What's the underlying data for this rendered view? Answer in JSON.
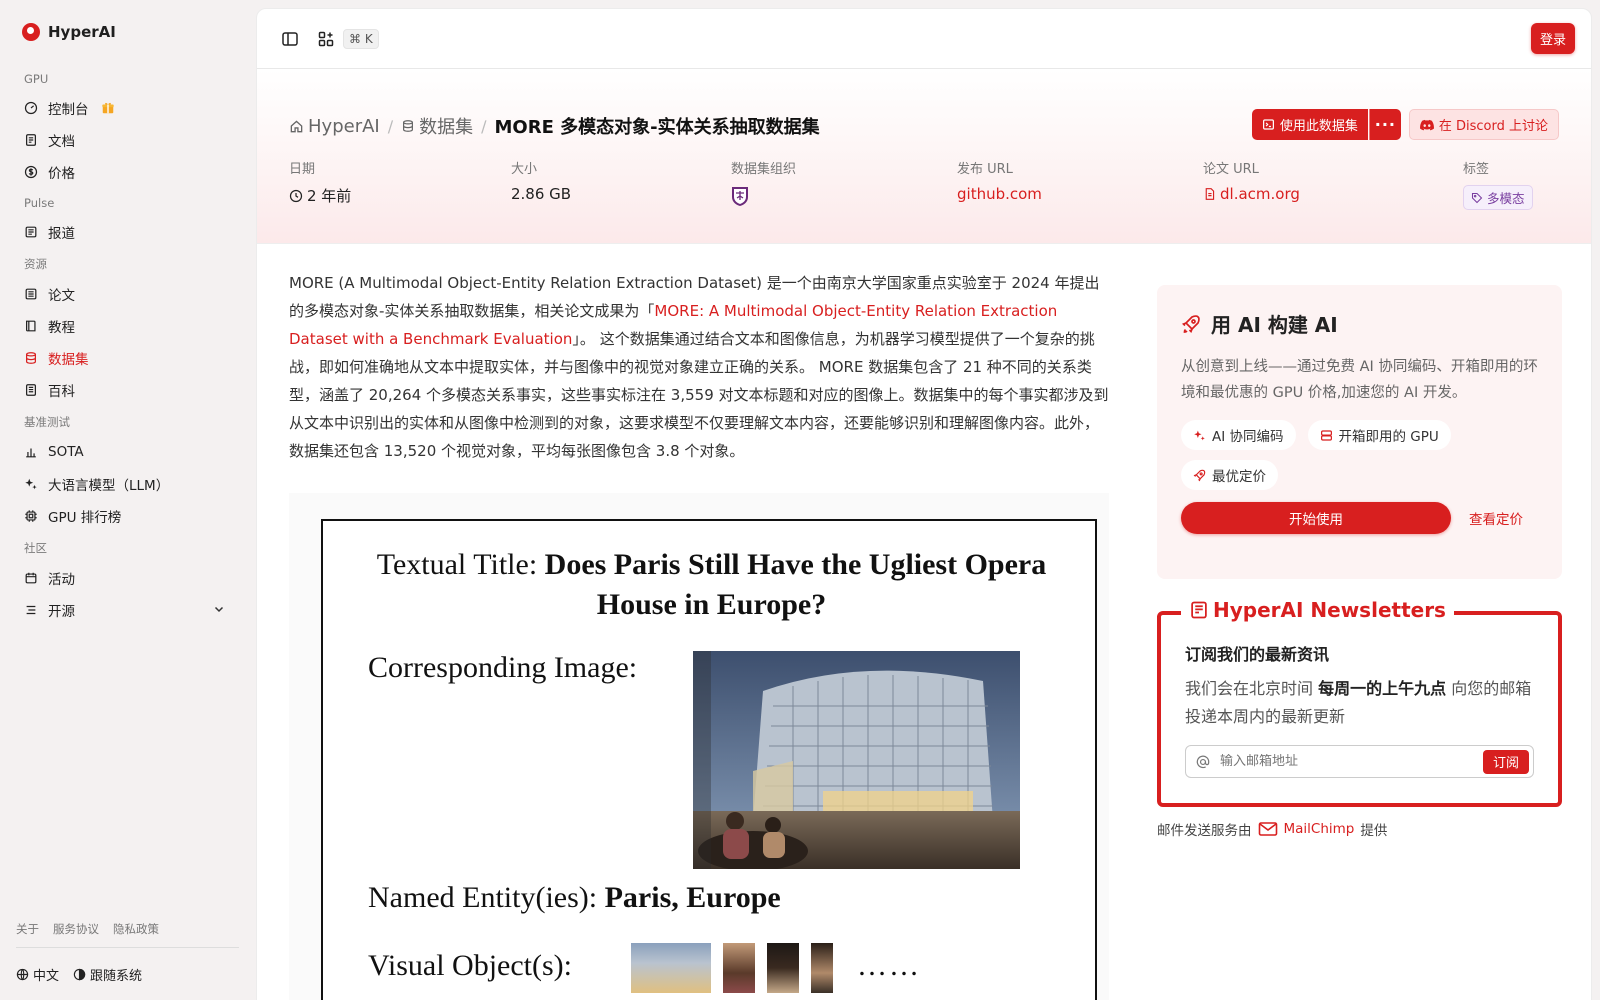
{
  "sidebar": {
    "brand": "HyperAI",
    "sections": {
      "gpu": "GPU",
      "pulse": "Pulse",
      "resources": "资源",
      "bench": "基准测试",
      "community": "社区"
    },
    "items": {
      "console": "控制台",
      "docs": "文档",
      "pricing": "价格",
      "reports": "报道",
      "papers": "论文",
      "tutorials": "教程",
      "datasets": "数据集",
      "wiki": "百科",
      "sota": "SOTA",
      "llm": "大语言模型（LLM）",
      "gpu_rank": "GPU 排行榜",
      "events": "活动",
      "opensource": "开源"
    },
    "footer_links": [
      "关于",
      "服务协议",
      "隐私政策"
    ],
    "language": "中文",
    "theme": "跟随系统"
  },
  "topbar": {
    "shortcut": "⌘ K",
    "login": "登录"
  },
  "hero": {
    "crumb_home": "HyperAI",
    "crumb_datasets": "数据集",
    "crumb_current": "MORE 多模态对象-实体关系抽取数据集",
    "btn_use": "使用此数据集",
    "btn_discord": "在 Discord 上讨论",
    "meta": {
      "date_label": "日期",
      "date_value": "2 年前",
      "size_label": "大小",
      "size_value": "2.86 GB",
      "org_label": "数据集组织",
      "release_label": "发布 URL",
      "release_value": "github.com",
      "paper_label": "论文 URL",
      "paper_value": "dl.acm.org",
      "tags_label": "标签",
      "tag_value": "多模态"
    }
  },
  "content": {
    "desc_before": "MORE (A Multimodal Object-Entity Relation Extraction Dataset) 是一个由南京大学国家重点实验室于 2024 年提出的多模态对象-实体关系抽取数据集，相关论文成果为「",
    "desc_link": "MORE: A Multimodal Object-Entity Relation Extraction Dataset with a Benchmark Evaluation",
    "desc_after": "」。 这个数据集通过结合文本和图像信息，为机器学习模型提供了一个复杂的挑战，即如何准确地从文本中提取实体，并与图像中的视觉对象建立正确的关系。 MORE 数据集包含了 21 种不同的关系类型，涵盖了 20,264 个多模态关系事实，这些事实标注在 3,559 对文本标题和对应的图像上。数据集中的每个事实都涉及到从文本中识别出的实体和从图像中检测到的对象，这要求模型不仅要理解文本内容，还要能够识别和理解图像内容。此外，数据集还包含 13,520 个视觉对象，平均每张图像包含 3.8 个对象。",
    "figure": {
      "title_prefix": "Textual Title: ",
      "title_bold": "Does Paris Still Have the Ugliest Opera House in Europe?",
      "corr_label": "Corresponding Image:",
      "ne_prefix": "Named Entity(ies): ",
      "ne_bold": "Paris, Europe",
      "vo_label": "Visual Object(s):",
      "vo_more": "……"
    }
  },
  "card_ai": {
    "title": "用 AI 构建 AI",
    "body": "从创意到上线——通过免费 AI 协同编码、开箱即用的环境和最优惠的 GPU 价格,加速您的 AI 开发。",
    "pills": [
      "AI 协同编码",
      "开箱即用的 GPU",
      "最优定价"
    ],
    "start": "开始使用",
    "price": "查看定价"
  },
  "newsletter": {
    "legend": "HyperAI Newsletters",
    "heading": "订阅我们的最新资讯",
    "body_before": "我们会在北京时间 ",
    "body_bold": "每周一的上午九点",
    "body_after": " 向您的邮箱投递本周内的最新更新",
    "placeholder": "输入邮箱地址",
    "subscribe": "订阅",
    "note_before": "邮件发送服务由",
    "note_brand": "MailChimp",
    "note_after": "提供"
  },
  "colors": {
    "accent": "#d81f1f",
    "sidebar_bg": "#f4f1f1",
    "tag": "#7a3fa0"
  }
}
